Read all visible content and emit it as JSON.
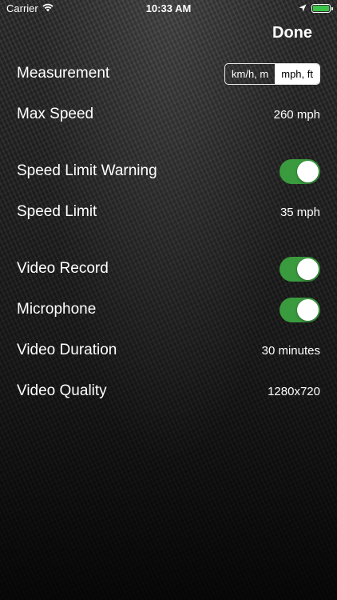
{
  "status_bar": {
    "carrier": "Carrier",
    "time": "10:33 AM",
    "battery_color": "#3cc44a",
    "icons": [
      "wifi-icon",
      "location-arrow-icon",
      "battery-icon"
    ]
  },
  "nav": {
    "done_label": "Done"
  },
  "measurement": {
    "label": "Measurement",
    "options": [
      "km/h, m",
      "mph, ft"
    ],
    "selected": "mph, ft"
  },
  "max_speed": {
    "label": "Max Speed",
    "value": "260 mph"
  },
  "speed_limit_warning": {
    "label": "Speed Limit Warning",
    "enabled": true
  },
  "speed_limit": {
    "label": "Speed Limit",
    "value": "35 mph"
  },
  "video_record": {
    "label": "Video Record",
    "enabled": true
  },
  "microphone": {
    "label": "Microphone",
    "enabled": true
  },
  "video_duration": {
    "label": "Video Duration",
    "value": "30 minutes"
  },
  "video_quality": {
    "label": "Video Quality",
    "value": "1280x720"
  },
  "colors": {
    "toggle_on": "#3a9b3e"
  }
}
